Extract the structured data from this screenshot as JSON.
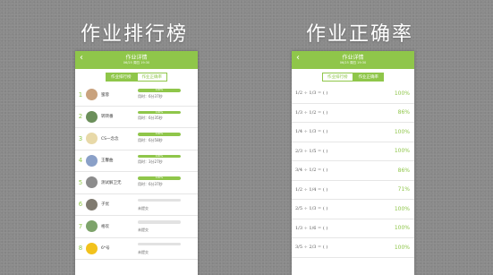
{
  "left": {
    "heading": "作业排行榜",
    "header_title": "作业详情",
    "header_sub": "06/25 周四 19:30",
    "tabs": [
      "作业排行榜",
      "作业正确率"
    ],
    "rows": [
      {
        "rank": "1",
        "name": "蜜蓉",
        "progress": 100,
        "progress_label": "100%",
        "time": "用时：6分37秒",
        "avatar": "#c9a27d"
      },
      {
        "rank": "2",
        "name": "转转番",
        "progress": 100,
        "progress_label": "100%",
        "time": "用时：6分35秒",
        "avatar": "#6b8f5a"
      },
      {
        "rank": "3",
        "name": "CS一念念",
        "progress": 100,
        "progress_label": "100%",
        "time": "用时：6分58秒",
        "avatar": "#e8d9a8"
      },
      {
        "rank": "4",
        "name": "王馨曲",
        "progress": 100,
        "progress_label": "100%",
        "time": "用时：3分27秒",
        "avatar": "#8aa0c8"
      },
      {
        "rank": "5",
        "name": "测试解卫无",
        "progress": 100,
        "progress_label": "100%",
        "time": "用时：6分37秒",
        "avatar": "#8c8c8c"
      },
      {
        "rank": "6",
        "name": "子优",
        "progress": 0,
        "status": "未提交",
        "avatar": "#7f7a6f"
      },
      {
        "rank": "7",
        "name": "格欢",
        "progress": 0,
        "status": "未提交",
        "avatar": "#7da36a"
      },
      {
        "rank": "8",
        "name": "6*号",
        "progress": 0,
        "status": "未提交",
        "avatar": "#f2c21c"
      }
    ]
  },
  "right": {
    "heading": "作业正确率",
    "header_title": "作业详情",
    "header_sub": "06/25 周四 19:30",
    "tabs": [
      "作业排行榜",
      "作业正确率"
    ],
    "rows": [
      {
        "q": "1/2 ÷ 1/3 = (  )",
        "pct": "100%"
      },
      {
        "q": "1/3 ÷ 1/2 = (  )",
        "pct": "86%"
      },
      {
        "q": "1/4 ÷ 1/3 = (  )",
        "pct": "100%"
      },
      {
        "q": "2/3 ÷ 1/5 = (  )",
        "pct": "100%"
      },
      {
        "q": "3/4 ÷ 1/2 = (  )",
        "pct": "86%"
      },
      {
        "q": "1/2 ÷ 1/4 = (  )",
        "pct": "71%"
      },
      {
        "q": "2/5 ÷ 1/3 = (  )",
        "pct": "100%"
      },
      {
        "q": "1/3 ÷ 1/6 = (  )",
        "pct": "100%"
      },
      {
        "q": "3/5 ÷ 2/3 = (  )",
        "pct": "100%"
      }
    ]
  }
}
